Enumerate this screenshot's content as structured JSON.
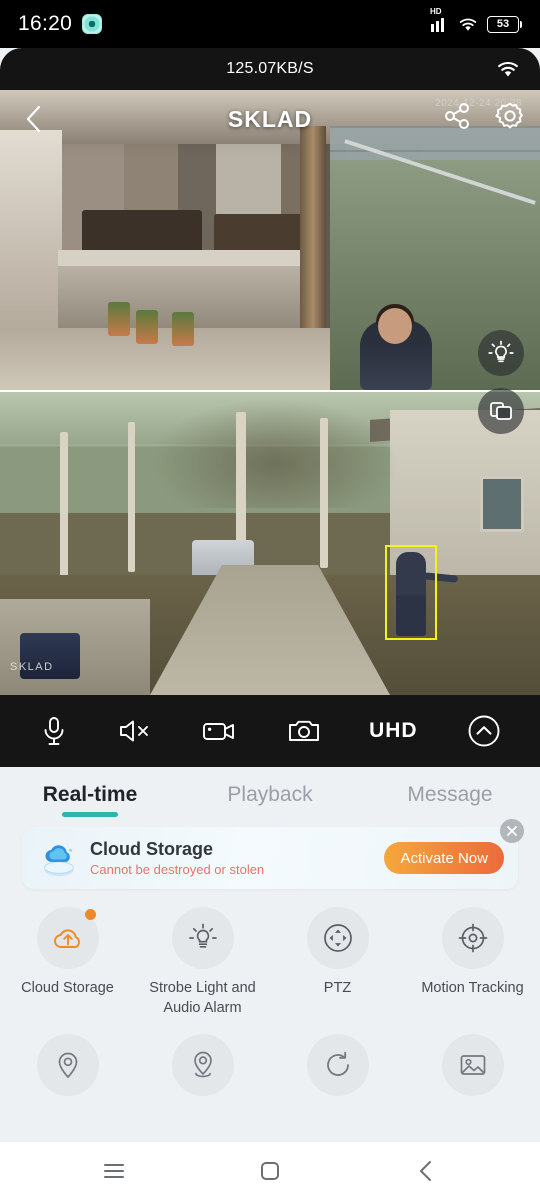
{
  "status_bar": {
    "time": "16:20",
    "app_icon": "camera-app-icon",
    "network_type": "HD",
    "signal_icon": "cellular-signal-icon",
    "wifi_icon": "wifi-icon",
    "battery_percent": "53"
  },
  "bandwidth": {
    "rate": "125.07KB/S",
    "wifi_icon": "wifi-icon"
  },
  "video": {
    "title": "SKLAD",
    "back_icon": "chevron-left-icon",
    "share_icon": "share-nodes-icon",
    "settings_icon": "gear-icon",
    "timestamp_overlay": "2024-12-24 20:38",
    "watermark": "SKLAD",
    "detection_box_color": "#f5f11a",
    "float_buttons": [
      {
        "name": "spotlight-button",
        "icon": "light-bulb-icon"
      },
      {
        "name": "split-screen-button",
        "icon": "multi-window-icon"
      }
    ]
  },
  "toolbar": {
    "items": [
      {
        "name": "microphone-button",
        "icon": "microphone-icon",
        "label": ""
      },
      {
        "name": "mute-button",
        "icon": "speaker-muted-icon",
        "label": ""
      },
      {
        "name": "record-button",
        "icon": "video-camera-icon",
        "label": ""
      },
      {
        "name": "snapshot-button",
        "icon": "camera-icon",
        "label": ""
      },
      {
        "name": "quality-button",
        "icon": "text-label",
        "label": "UHD"
      },
      {
        "name": "expand-button",
        "icon": "chevron-up-circle-icon",
        "label": ""
      }
    ]
  },
  "tabs": {
    "items": [
      {
        "label": "Real-time",
        "active": true
      },
      {
        "label": "Playback",
        "active": false
      },
      {
        "label": "Message",
        "active": false
      }
    ],
    "active_color": "#2fb3ad"
  },
  "promo": {
    "icon": "cloud-storage-icon",
    "title": "Cloud Storage",
    "subtitle": "Cannot be destroyed or stolen",
    "cta_label": "Activate Now",
    "close_icon": "close-icon",
    "cta_color_start": "#f5a83c",
    "cta_color_end": "#ec6a3c",
    "subtitle_color": "#e8736b"
  },
  "features": {
    "row1": [
      {
        "label": "Cloud Storage",
        "icon": "cloud-upload-icon",
        "badge": true,
        "accent": "#f08a28"
      },
      {
        "label": "Strobe Light and Audio Alarm",
        "icon": "light-bulb-icon",
        "badge": false,
        "accent": "#595f66"
      },
      {
        "label": "PTZ",
        "icon": "ptz-pan-tilt-icon",
        "badge": false,
        "accent": "#595f66"
      },
      {
        "label": "Motion Tracking",
        "icon": "crosshair-target-icon",
        "badge": false,
        "accent": "#595f66"
      }
    ],
    "row2": [
      {
        "label": "",
        "icon": "location-pin-icon",
        "badge": false,
        "accent": "#737980"
      },
      {
        "label": "",
        "icon": "location-preset-pin-icon",
        "badge": false,
        "accent": "#737980"
      },
      {
        "label": "",
        "icon": "refresh-rotate-icon",
        "badge": false,
        "accent": "#737980"
      },
      {
        "label": "",
        "icon": "image-album-icon",
        "badge": false,
        "accent": "#737980"
      }
    ]
  },
  "navbar": {
    "recents_icon": "menu-recents-icon",
    "home_icon": "home-square-icon",
    "back_icon": "back-chevron-icon"
  }
}
